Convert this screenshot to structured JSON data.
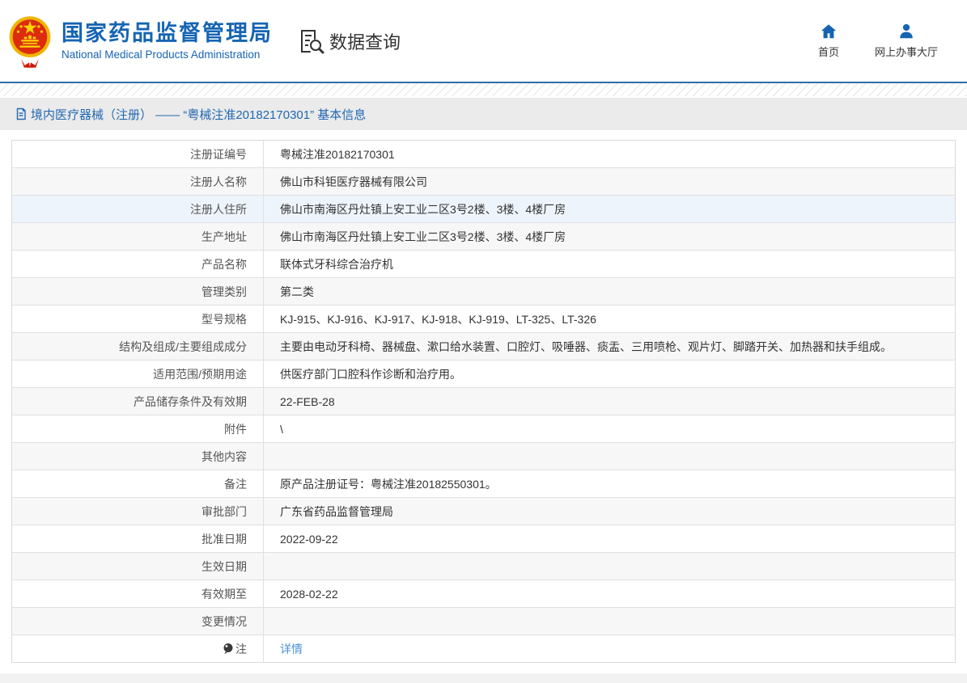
{
  "header": {
    "logo": {
      "title": "国家药品监督管理局",
      "subtitle": "National Medical Products Administration",
      "emblem_icon": "china-national-emblem"
    },
    "section_label": "数据查询",
    "section_icon": "document-search-icon",
    "nav": [
      {
        "label": "首页",
        "icon": "home-icon"
      },
      {
        "label": "网上办事大厅",
        "icon": "person-icon"
      }
    ]
  },
  "breadcrumb": {
    "icon": "document-icon",
    "text": "境内医疗器械（注册） —— “粤械注准20182170301” 基本信息"
  },
  "table": {
    "highlighted_row": 2,
    "rows": [
      {
        "label": "注册证编号",
        "value": "粤械注准20182170301"
      },
      {
        "label": "注册人名称",
        "value": "佛山市科钜医疗器械有限公司"
      },
      {
        "label": "注册人住所",
        "value": "佛山市南海区丹灶镇上安工业二区3号2楼、3楼、4楼厂房"
      },
      {
        "label": "生产地址",
        "value": "佛山市南海区丹灶镇上安工业二区3号2楼、3楼、4楼厂房"
      },
      {
        "label": "产品名称",
        "value": "联体式牙科综合治疗机"
      },
      {
        "label": "管理类别",
        "value": "第二类"
      },
      {
        "label": "型号规格",
        "value": "KJ-915、KJ-916、KJ-917、KJ-918、KJ-919、LT-325、LT-326"
      },
      {
        "label": "结构及组成/主要组成成分",
        "value": "主要由电动牙科椅、器械盘、漱口给水装置、口腔灯、吸唾器、痰盂、三用喷枪、观片灯、脚踏开关、加热器和扶手组成。"
      },
      {
        "label": "适用范围/预期用途",
        "value": "供医疗部门口腔科作诊断和治疗用。"
      },
      {
        "label": "产品储存条件及有效期",
        "value": "22-FEB-28"
      },
      {
        "label": "附件",
        "value": "\\"
      },
      {
        "label": "其他内容",
        "value": ""
      },
      {
        "label": "备注",
        "value": "原产品注册证号：粤械注准20182550301。"
      },
      {
        "label": "审批部门",
        "value": "广东省药品监督管理局"
      },
      {
        "label": "批准日期",
        "value": "2022-09-22"
      },
      {
        "label": "生效日期",
        "value": ""
      },
      {
        "label": "有效期至",
        "value": "2028-02-22"
      },
      {
        "label": "变更情况",
        "value": ""
      },
      {
        "label": "注",
        "label_icon": "balloon-icon",
        "value": "详情",
        "link": true
      }
    ]
  },
  "colors": {
    "brand_blue": "#1664b2",
    "link_blue": "#4a90d9",
    "bar_bg": "#ebebeb",
    "row_alt_bg": "#f7f7f7",
    "row_hover_bg": "#eef4fb",
    "border": "#e0e0e0",
    "text_dark": "#333333",
    "label_gray": "#555555"
  }
}
